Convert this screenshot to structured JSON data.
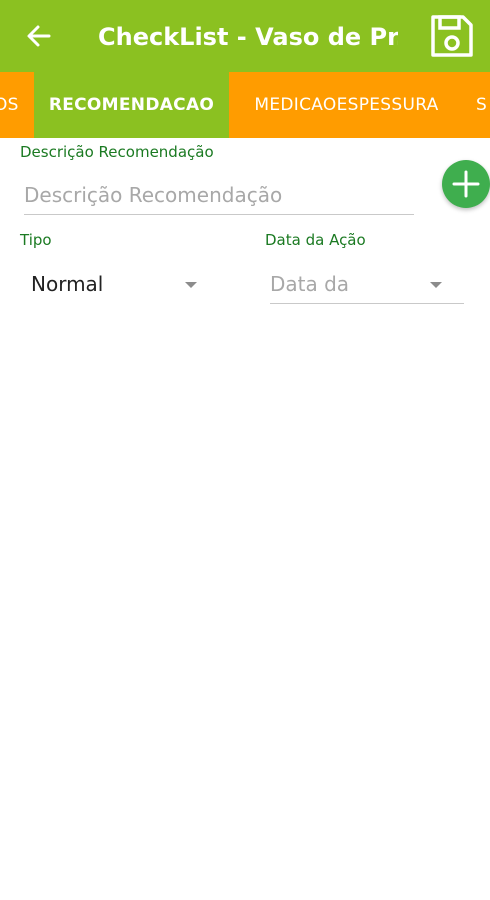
{
  "app_bar": {
    "title": "CheckList - Vaso de Pr...",
    "back_icon": "arrow-left-icon",
    "save_icon": "floppy-disk-icon"
  },
  "tabs": [
    {
      "label": "OS"
    },
    {
      "label": "RECOMENDACAO",
      "active": true
    },
    {
      "label": "MEDICAOESPESSURA"
    },
    {
      "label": "S"
    }
  ],
  "form": {
    "descricao_label": "Descrição Recomendação",
    "descricao_placeholder": "Descrição Recomendação",
    "add_icon": "plus-icon",
    "tipo_label": "Tipo",
    "tipo_value": "Normal",
    "data_label": "Data da Ação",
    "data_placeholder": "Data da"
  },
  "colors": {
    "app_bar": "#8bc121",
    "tab_bar": "#ff9c00",
    "label_green": "#1b7a22",
    "fab": "#3fae4e"
  }
}
